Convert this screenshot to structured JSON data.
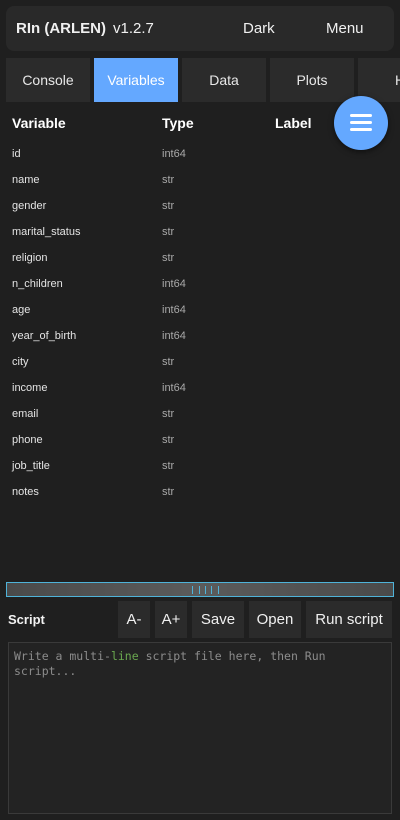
{
  "header": {
    "title": "RIn (ARLEN)",
    "version": "v1.2.7",
    "theme_button": "Dark",
    "menu_button": "Menu"
  },
  "tabs": [
    {
      "label": "Console",
      "active": false
    },
    {
      "label": "Variables",
      "active": true
    },
    {
      "label": "Data",
      "active": false
    },
    {
      "label": "Plots",
      "active": false
    },
    {
      "label": "H",
      "active": false
    }
  ],
  "fab": {
    "icon": "hamburger-menu-icon"
  },
  "variables": {
    "columns": [
      "Variable",
      "Type",
      "Label"
    ],
    "rows": [
      {
        "name": "id",
        "type": "int64"
      },
      {
        "name": "name",
        "type": "str"
      },
      {
        "name": "gender",
        "type": "str"
      },
      {
        "name": "marital_status",
        "type": "str"
      },
      {
        "name": "religion",
        "type": "str"
      },
      {
        "name": "n_children",
        "type": "int64"
      },
      {
        "name": "age",
        "type": "int64"
      },
      {
        "name": "year_of_birth",
        "type": "int64"
      },
      {
        "name": "city",
        "type": "str"
      },
      {
        "name": "income",
        "type": "int64"
      },
      {
        "name": "email",
        "type": "str"
      },
      {
        "name": "phone",
        "type": "str"
      },
      {
        "name": "job_title",
        "type": "str"
      },
      {
        "name": "notes",
        "type": "str"
      }
    ]
  },
  "script": {
    "label": "Script",
    "buttons": {
      "font_smaller": "A-",
      "font_larger": "A+",
      "save": "Save",
      "open": "Open",
      "run": "Run script"
    },
    "placeholder_before": "Write a multi-",
    "placeholder_keyword": "line",
    "placeholder_after": " script file here, then Run script..."
  },
  "colors": {
    "accent": "#64a8ff",
    "background": "#1f1f1f",
    "splitter_border": "#4fb3d9"
  }
}
